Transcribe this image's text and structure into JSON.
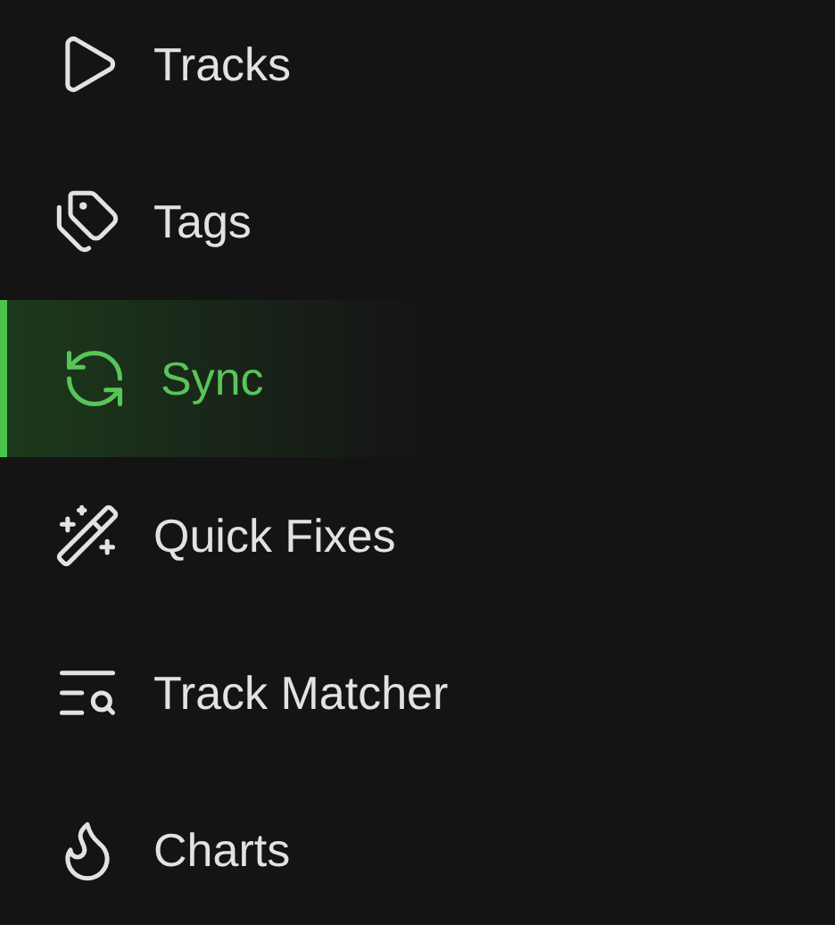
{
  "nav": [
    {
      "label": "Tracks",
      "selected": false
    },
    {
      "label": "Tags",
      "selected": false
    },
    {
      "label": "Sync",
      "selected": true
    },
    {
      "label": "Quick Fixes",
      "selected": false
    },
    {
      "label": "Track Matcher",
      "selected": false
    },
    {
      "label": "Charts",
      "selected": false
    }
  ]
}
